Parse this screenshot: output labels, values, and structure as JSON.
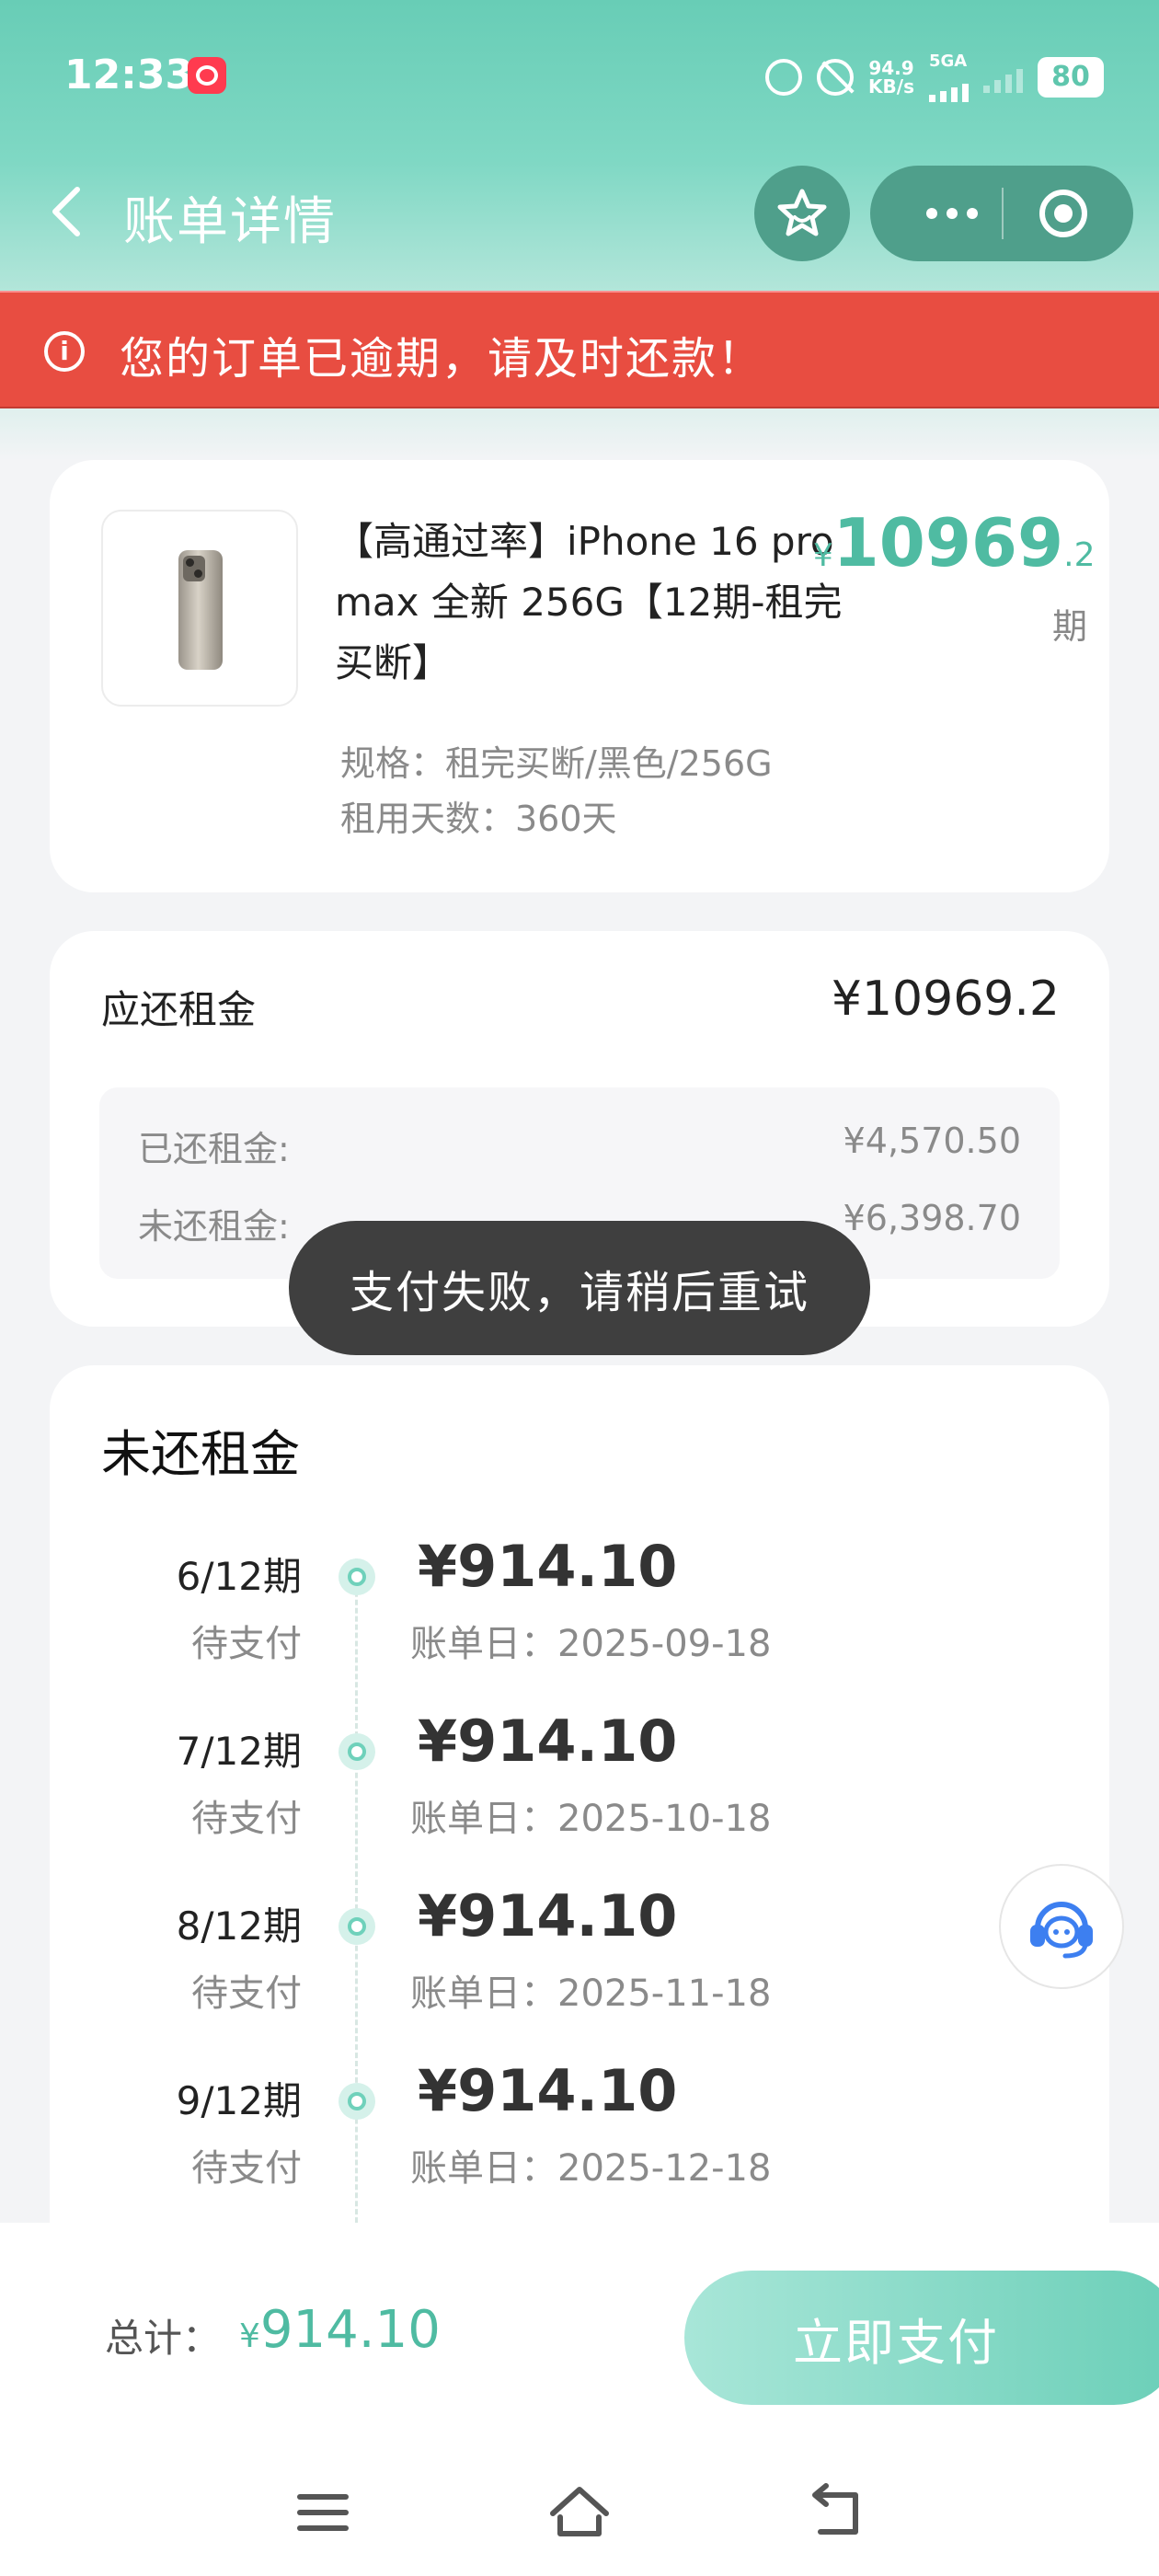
{
  "status_bar": {
    "time": "12:33",
    "net_speed_value": "94.9",
    "net_speed_unit": "KB/s",
    "network_type": "5GA",
    "battery": "80"
  },
  "nav": {
    "title": "账单详情",
    "icons": [
      "back-icon",
      "star-icon",
      "more-icon",
      "target-icon"
    ]
  },
  "alert": {
    "text": "您的订单已逾期，请及时还款！",
    "color": "#e84d41"
  },
  "product": {
    "title": "【高通过率】iPhone 16 pro max 全新 256G【12期-租完买断】",
    "price_currency": "¥",
    "price_int": "10969",
    "price_dec": ".2",
    "price_unit": "期",
    "spec": "规格：租完买断/黑色/256G",
    "days": "租用天数：360天"
  },
  "rent": {
    "label": "应还租金",
    "total": "¥10969.2",
    "paid_label": "已还租金:",
    "paid_value": "¥4,570.50",
    "unpaid_label": "未还租金:",
    "unpaid_value": "¥6,398.70"
  },
  "toast": {
    "text": "支付失败，请稍后重试"
  },
  "unpaid_section": {
    "title": "未还租金",
    "periods": [
      {
        "no": "6/12期",
        "status": "待支付",
        "amount": "¥914.10",
        "date": "账单日：2025-09-18"
      },
      {
        "no": "7/12期",
        "status": "待支付",
        "amount": "¥914.10",
        "date": "账单日：2025-10-18"
      },
      {
        "no": "8/12期",
        "status": "待支付",
        "amount": "¥914.10",
        "date": "账单日：2025-11-18"
      },
      {
        "no": "9/12期",
        "status": "待支付",
        "amount": "¥914.10",
        "date": "账单日：2025-12-18"
      }
    ]
  },
  "footer": {
    "total_label": "总计：",
    "total_currency": "¥",
    "total_value": "914.10",
    "pay_button": "立即支付"
  },
  "colors": {
    "accent": "#4fbba2",
    "header_gradient": "#68cdb6",
    "toast_bg": "#3f3f3f"
  }
}
